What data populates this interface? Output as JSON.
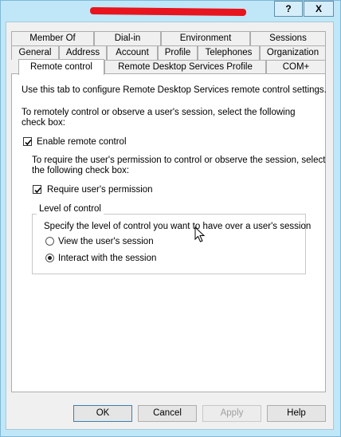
{
  "title": {
    "help_label": "?",
    "close_label": "X"
  },
  "tabs": {
    "row1": [
      "Member Of",
      "Dial-in",
      "Environment",
      "Sessions"
    ],
    "row2": [
      "General",
      "Address",
      "Account",
      "Profile",
      "Telephones",
      "Organization"
    ],
    "row3": [
      "Remote control",
      "Remote Desktop Services Profile",
      "COM+"
    ],
    "selected": "Remote control"
  },
  "panel": {
    "intro": "Use this tab to configure Remote Desktop Services remote control settings.",
    "instruction_line1": "To remotely control or observe a user's session, select the following",
    "instruction_line2": "check box:",
    "enable_remote_control": {
      "label": "Enable remote control",
      "checked": true
    },
    "permission_line1": "To require the user's permission to control or observe the session, select",
    "permission_line2": "the following check box:",
    "require_permission": {
      "label": "Require user's permission",
      "checked": true
    },
    "level_group": {
      "legend": "Level of control",
      "description": "Specify the level of control you want to have over a user's session",
      "options": [
        {
          "label": "View the user's session",
          "selected": false
        },
        {
          "label": "Interact with the session",
          "selected": true
        }
      ]
    }
  },
  "buttons": {
    "ok": "OK",
    "cancel": "Cancel",
    "apply": "Apply",
    "help": "Help"
  }
}
